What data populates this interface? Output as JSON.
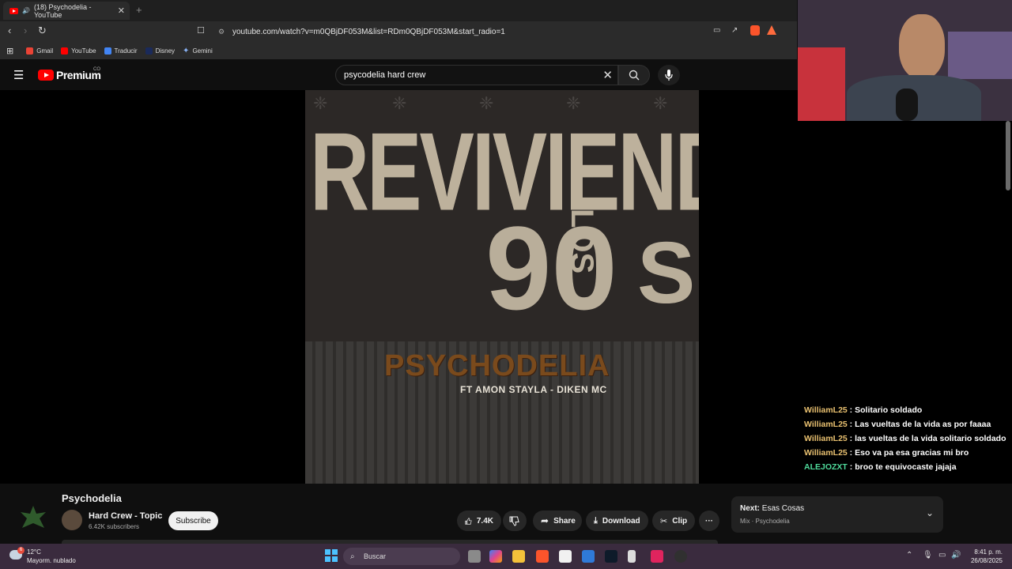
{
  "browser": {
    "tab_title": "(18) Psychodelia - YouTube",
    "new_tab": "+",
    "tab_close": "✕",
    "url": "youtube.com/watch?v=m0QBjDF053M&list=RDm0QBjDF053M&start_radio=1",
    "bookmarks": [
      {
        "label": "Gmail",
        "color": "#ea4335"
      },
      {
        "label": "YouTube",
        "color": "#ff0000"
      },
      {
        "label": "Traducir",
        "color": "#4285f4"
      },
      {
        "label": "Disney",
        "color": "#1a2a5a"
      },
      {
        "label": "Gemini",
        "color": "#8ab4f8"
      }
    ]
  },
  "youtube": {
    "logo_text": "Premium",
    "country": "CO",
    "search_value": "psycodelia hard crew"
  },
  "artwork": {
    "line1": "REVIVIENDO",
    "line2": "90",
    "line3": "LOS",
    "line4": "S",
    "band": "PSYCHODELIA",
    "featuring": "FT AMON STAYLA - DIKEN MC"
  },
  "chat": [
    {
      "user": "WilliamL25",
      "msg": "Solitario soldado",
      "color": "#e8c070"
    },
    {
      "user": "WilliamL25",
      "msg": "Las vueltas de la vida as por faaaa",
      "color": "#e8c070"
    },
    {
      "user": "WilliamL25",
      "msg": "las vueltas de la vida solitario soldado",
      "color": "#e8c070"
    },
    {
      "user": "WilliamL25",
      "msg": "Eso va pa esa gracias mi bro",
      "color": "#e8c070"
    },
    {
      "user": "ALEJOZXT",
      "msg": "broo te equivocaste jajaja",
      "color": "#4fd99a"
    }
  ],
  "video": {
    "title": "Psychodelia",
    "channel": "Hard Crew - Topic",
    "subscribers": "6.42K subscribers",
    "subscribe": "Subscribe",
    "likes": "7.4K",
    "share": "Share",
    "download": "Download",
    "clip": "Clip",
    "more": "···"
  },
  "next": {
    "label": "Next:",
    "title": "Esas Cosas",
    "sub": "Mix · Psychodelia"
  },
  "taskbar": {
    "temp": "12°C",
    "weather": "Mayorm. nublado",
    "weather_badge": "6",
    "search": "Buscar",
    "time": "8:41 p. m.",
    "date": "26/08/2025"
  }
}
